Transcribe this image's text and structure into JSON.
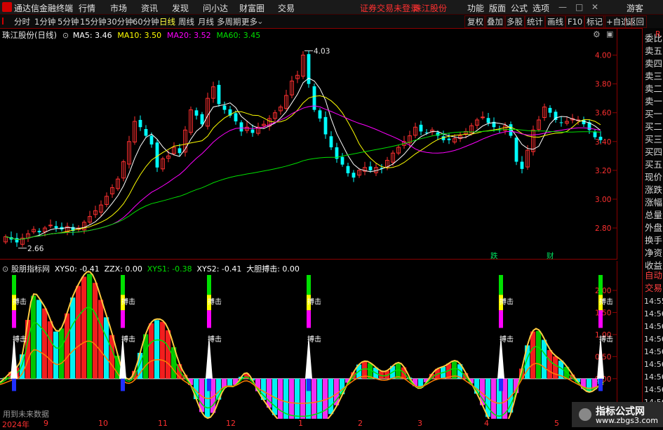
{
  "menubar": {
    "app_title": "通达信金融终端",
    "items": [
      "行情",
      "市场",
      "资讯",
      "发现",
      "问小达",
      "财富圈",
      "交易"
    ],
    "warning": "证券交易未登录",
    "stock": "珠江股份",
    "right_items": [
      "功能",
      "版面",
      "公式",
      "选项"
    ],
    "guest": "游客",
    "window_controls": [
      "—",
      "□",
      "✕"
    ]
  },
  "toolbar": {
    "periods": [
      "分时",
      "1分钟",
      "5分钟",
      "15分钟",
      "30分钟",
      "60分钟",
      "日线",
      "周线",
      "月线",
      "多周期",
      "更多"
    ],
    "active_period": "日线",
    "right_buttons": [
      "复权",
      "叠加",
      "多股",
      "统计",
      "画线",
      "F10",
      "标记",
      "+自选",
      "返回"
    ]
  },
  "main_chart": {
    "title": "珠江股份(日线)",
    "ma": [
      {
        "label": "MA5: 3.46",
        "color": "#ffffff"
      },
      {
        "label": "MA10: 3.50",
        "color": "#ffff00"
      },
      {
        "label": "MA20: 3.52",
        "color": "#ff00ff"
      },
      {
        "label": "MA60: 3.45",
        "color": "#00e000"
      }
    ],
    "high_label": "4.03",
    "low_label": "2.66",
    "y_ticks": [
      "4.00",
      "3.80",
      "3.60",
      "3.40",
      "3.20",
      "3.00",
      "2.80"
    ],
    "event_marks": [
      "跌",
      "财"
    ]
  },
  "indicator": {
    "name": "股朋指标网",
    "values": [
      {
        "label": "XYS0: -0.41",
        "color": "#ffffff"
      },
      {
        "label": "ZZX: 0.00",
        "color": "#ffffff"
      },
      {
        "label": "XYS1: -0.38",
        "color": "#00e000"
      },
      {
        "label": "XYS2: -0.41",
        "color": "#ffffff"
      },
      {
        "label": "大胆搏击: 0.00",
        "color": "#ffffff"
      }
    ],
    "signal_text": "搏击",
    "y_ticks": [
      "2.00",
      "1.50",
      "1.00",
      "0.50",
      "0.00"
    ],
    "footnote": "用到未来数据"
  },
  "date_axis": [
    "2024年",
    "9",
    "10",
    "11",
    "12",
    "1",
    "2",
    "3",
    "4",
    "5"
  ],
  "side_panel": {
    "r_badge": "R",
    "items": [
      "委比",
      "卖五",
      "卖四",
      "卖三",
      "卖二",
      "卖一",
      "买一",
      "买二",
      "买三",
      "买四",
      "买五",
      "现价",
      "涨跌",
      "涨幅",
      "总量",
      "外盘",
      "换手",
      "净资",
      "收益"
    ],
    "auto_trade": [
      "自动",
      "交易"
    ],
    "times": [
      "14:55",
      "14:56",
      "14:56",
      "14:56",
      "14:56",
      "14:56",
      "14:56",
      "14:56",
      "14:56"
    ]
  },
  "watermark": {
    "title": "指标公式网",
    "url": "www.zbgs3.com"
  },
  "colors": {
    "up": "#ff3030",
    "down": "#00ffff",
    "ma5": "#ffffff",
    "ma10": "#ffff00",
    "ma20": "#ff00ff",
    "ma60": "#00e000",
    "grid": "#8a0000"
  },
  "chart_data": {
    "type": "candlestick",
    "title": "珠江股份(日线)",
    "ylim": [
      2.62,
      4.1
    ],
    "closes": [
      2.74,
      2.72,
      2.7,
      2.73,
      2.76,
      2.79,
      2.77,
      2.8,
      2.82,
      2.8,
      2.79,
      2.81,
      2.78,
      2.8,
      2.84,
      2.88,
      2.92,
      2.96,
      3.02,
      3.08,
      3.14,
      3.26,
      3.4,
      3.54,
      3.5,
      3.44,
      3.38,
      3.22,
      3.28,
      3.3,
      3.36,
      3.32,
      3.48,
      3.62,
      3.58,
      3.52,
      3.7,
      3.78,
      3.66,
      3.62,
      3.58,
      3.54,
      3.47,
      3.5,
      3.46,
      3.5,
      3.52,
      3.56,
      3.6,
      3.64,
      3.72,
      3.82,
      3.86,
      4.0,
      3.8,
      3.62,
      3.56,
      3.45,
      3.36,
      3.28,
      3.24,
      3.18,
      3.15,
      3.2,
      3.22,
      3.2,
      3.22,
      3.21,
      3.27,
      3.32,
      3.36,
      3.4,
      3.44,
      3.5,
      3.47,
      3.46,
      3.48,
      3.44,
      3.41,
      3.41,
      3.42,
      3.44,
      3.47,
      3.51,
      3.55,
      3.57,
      3.53,
      3.5,
      3.48,
      3.51,
      3.44,
      3.26,
      3.21,
      3.34,
      3.48,
      3.55,
      3.64,
      3.6,
      3.55,
      3.53,
      3.54,
      3.56,
      3.55,
      3.52,
      3.48,
      3.43,
      3.41
    ],
    "ma_latest": {
      "MA5": 3.46,
      "MA10": 3.5,
      "MA20": 3.52,
      "MA60": 3.45
    },
    "high": 4.03,
    "low": 2.66,
    "indicator": {
      "XYS0": -0.41,
      "ZZX": 0.0,
      "XYS1": -0.38,
      "XYS2": -0.41,
      "大胆搏击": 0.0
    }
  }
}
